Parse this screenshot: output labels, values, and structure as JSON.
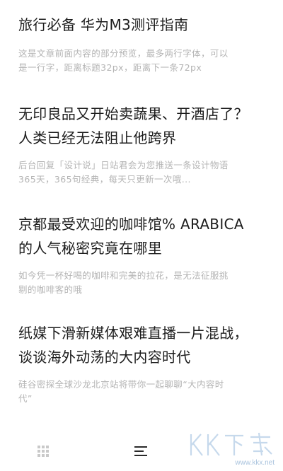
{
  "articles": [
    {
      "title": "旅行必备 华为M3测评指南",
      "preview": "这是文章前面内容的部分预览，最多两行字体，可以\n是一行字，距离标题32px，距离下一条72px"
    },
    {
      "title": "无印良品又开始卖蔬果、开酒店了？\n人类已经无法阻止他跨界",
      "preview": "后台回复「设计说」日站君会为您推送一条设计物语\n365天，365句经典，每天只更新一次哦..."
    },
    {
      "title": "京都最受欢迎的咖啡馆% ARABICA\n的人气秘密究竟在哪里",
      "preview": "如今凭一杯好喝的咖啡和完美的拉花，是无法征服挑\n剔的咖啡客的哦"
    },
    {
      "title": "纸媒下滑新媒体艰难直播一片混战，\n谈谈海外动荡的大内容时代",
      "preview": "硅谷密探全球沙龙北京站将带你一起聊聊“大内容时\n代”"
    }
  ],
  "bottom_bar": {
    "left_icon": "grid-icon",
    "center_icon": "list-icon",
    "active": "list-icon"
  },
  "watermark": {
    "logo_text": "KK下载",
    "site": "www.kkx.net"
  },
  "colors": {
    "title": "#1c1c1c",
    "preview": "#b4b4b4",
    "inactive_icon": "#c9c9c9",
    "active_icon": "#2a2a2a",
    "watermark": "#9ab8d8"
  }
}
